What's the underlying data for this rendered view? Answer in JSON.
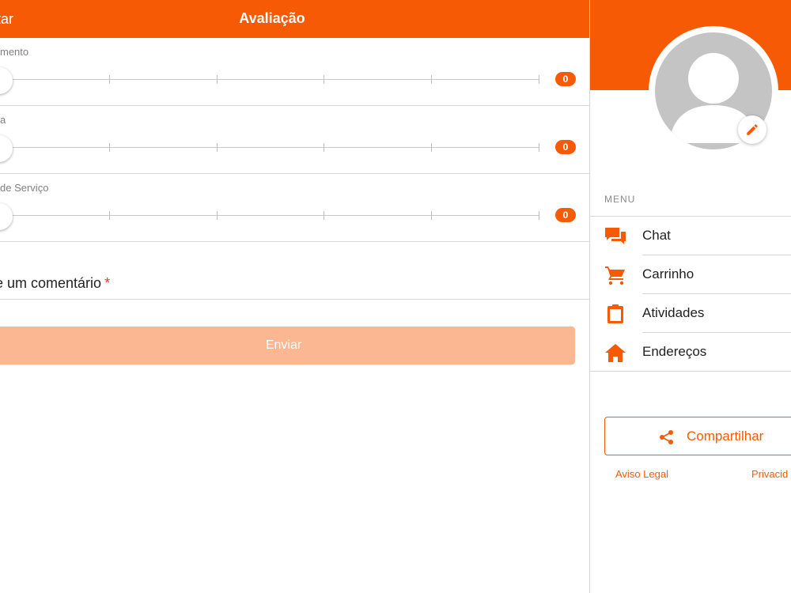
{
  "header": {
    "back_label": "tar",
    "title": "Avaliação"
  },
  "ratings": [
    {
      "label": "mento",
      "value": "0"
    },
    {
      "label": "a",
      "value": "0"
    },
    {
      "label": "de Serviço",
      "value": "0"
    }
  ],
  "comment": {
    "label": "e um comentário",
    "required_mark": "*"
  },
  "send_button": {
    "label": "Enviar"
  },
  "sidebar": {
    "menu_header": "MENU",
    "items": [
      {
        "label": "Chat",
        "icon": "chat-icon"
      },
      {
        "label": "Carrinho",
        "icon": "cart-icon"
      },
      {
        "label": "Atividades",
        "icon": "clipboard-icon"
      },
      {
        "label": "Endereços",
        "icon": "home-icon"
      }
    ],
    "share_label": "Compartilhar",
    "legal_link": "Aviso Legal",
    "privacy_link": "Privacid"
  },
  "colors": {
    "accent": "#f75a04",
    "disabled_button": "#fbb792",
    "avatar": "#c4c4c4"
  }
}
